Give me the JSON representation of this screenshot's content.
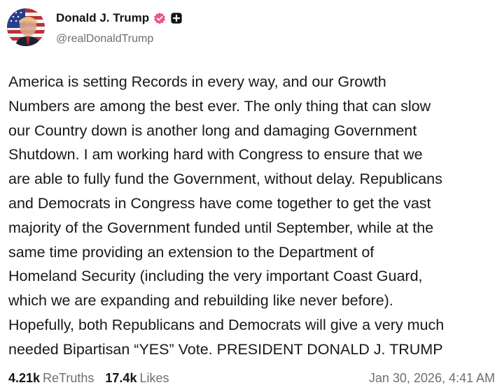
{
  "author": {
    "display_name": "Donald J. Trump",
    "handle": "@realDonaldTrump",
    "avatar_icon": "avatar-flag-portrait",
    "verified_icon": "verified-badge-icon",
    "verified_color": "#e8568f",
    "plus_icon": "plus-box-icon"
  },
  "post": {
    "text": "America is setting Records in every way, and our Growth\nNumbers are among the best ever. The only thing that can slow\nour Country down is another long and damaging Government\nShutdown. I am working hard with Congress to ensure that we\nare able to fully fund the Government, without delay. Republicans\nand Democrats in Congress have come together to get the vast\nmajority of the Government funded until September, while at the\nsame time providing an extension to the Department of\nHomeland Security (including the very important Coast Guard,\nwhich we are expanding and rebuilding like never before).\nHopefully, both Republicans and Democrats will give a very much\nneeded Bipartisan “YES” Vote. PRESIDENT DONALD J. TRUMP"
  },
  "stats": {
    "retruths_count": "4.21k",
    "retruths_label": "ReTruths",
    "likes_count": "17.4k",
    "likes_label": "Likes"
  },
  "timestamp": "Jan 30, 2026, 4:41 AM"
}
